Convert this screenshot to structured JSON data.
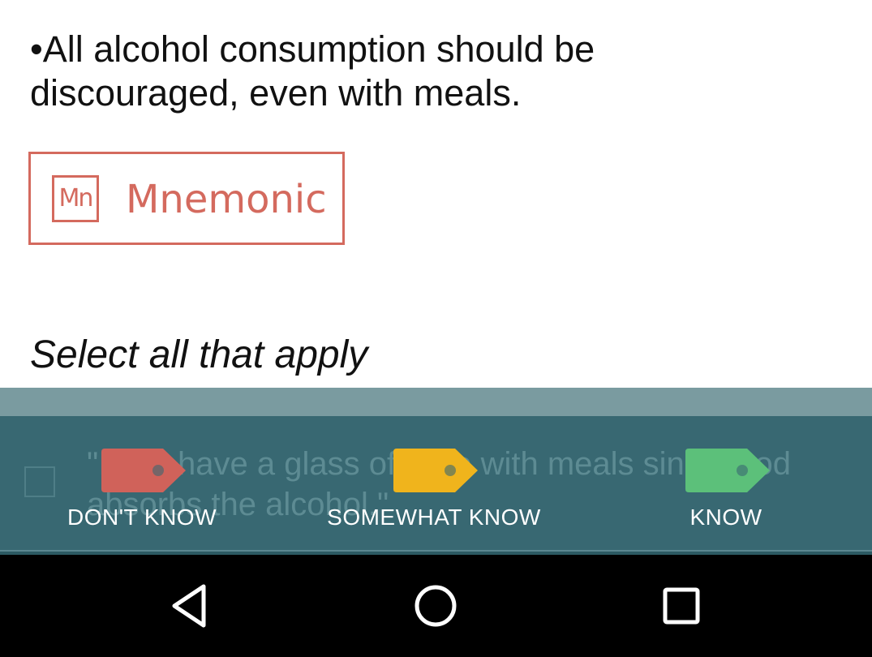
{
  "question": {
    "bullet_text": "•All alcohol consumption should be discouraged, even with meals."
  },
  "mnemonic": {
    "icon": "Mn",
    "label": "Mnemonic",
    "color": "#d46a5e"
  },
  "instruction": "Select all that apply",
  "answer": {
    "text": "\"I can have a glass of wine with meals since food absorbs the alcohol.\""
  },
  "ratings": [
    {
      "label": "DON'T KNOW",
      "color": "#d0625a"
    },
    {
      "label": "SOMEWHAT KNOW",
      "color": "#f0b41c"
    },
    {
      "label": "KNOW",
      "color": "#5cc07a"
    }
  ],
  "navbar": {
    "back": "back-icon",
    "home": "home-icon",
    "recents": "recents-icon"
  }
}
